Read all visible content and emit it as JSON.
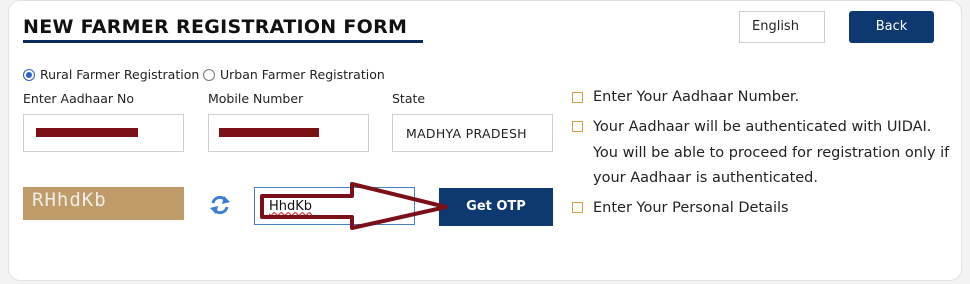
{
  "header": {
    "title": "NEW FARMER REGISTRATION FORM",
    "language": "English",
    "back_label": "Back"
  },
  "registration_type": {
    "options": [
      "Rural Farmer Registration",
      "Urban Farmer Registration"
    ],
    "selected": "Rural Farmer Registration"
  },
  "fields": {
    "aadhaar_label": "Enter Aadhaar No",
    "mobile_label": "Mobile Number",
    "state_label": "State",
    "state_value": "MADHYA PRADESH"
  },
  "captcha": {
    "image_text": "RHhdKb",
    "input_value": "HhdKb",
    "otp_label": "Get OTP"
  },
  "instructions": [
    "Enter Your Aadhaar Number.",
    "Your Aadhaar will be authenticated with UIDAI.",
    "You will be able to proceed for registration only if",
    "your Aadhaar is authenticated.",
    "Enter Your Personal Details"
  ],
  "colors": {
    "primary": "#0d3870",
    "captcha_bg": "#bf9b69",
    "annotation_arrow": "#7b1019",
    "checkbox_border": "#d99d43"
  }
}
